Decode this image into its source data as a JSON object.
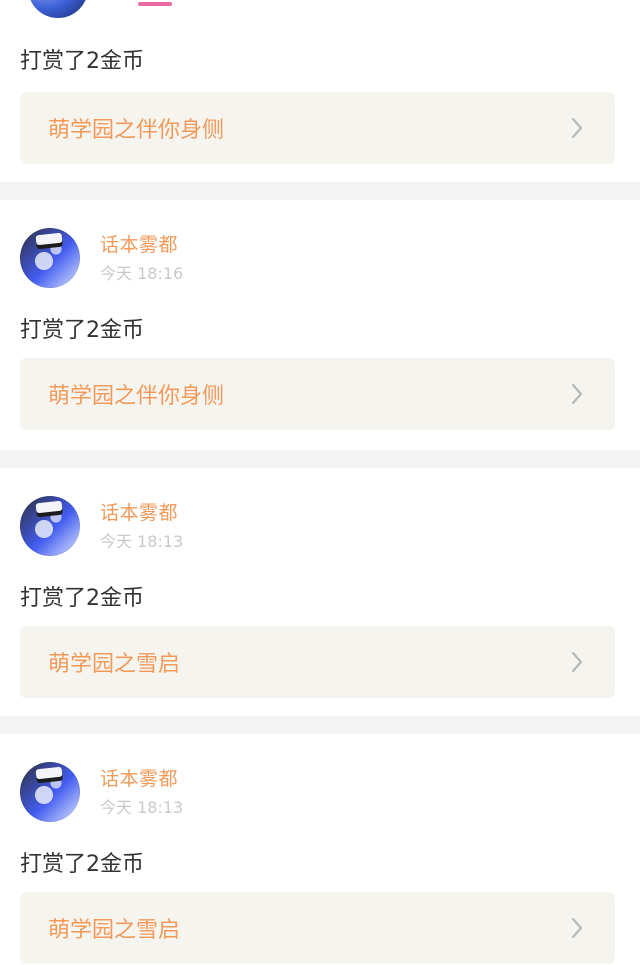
{
  "top_card": {
    "reward_text": "打赏了2金币",
    "link_title": "萌学园之伴你身侧"
  },
  "cards": [
    {
      "username": "话本雾都",
      "time": "今天 18:16",
      "reward_text": "打赏了2金币",
      "link_title": "萌学园之伴你身侧"
    },
    {
      "username": "话本雾都",
      "time": "今天 18:13",
      "reward_text": "打赏了2金币",
      "link_title": "萌学园之雪启"
    },
    {
      "username": "话本雾都",
      "time": "今天 18:13",
      "reward_text": "打赏了2金币",
      "link_title": "萌学园之雪启"
    }
  ],
  "icons": {
    "avatar": "anime-avatar-icon",
    "chevron": "chevron-right-icon"
  },
  "colors": {
    "accent_orange": "#f39a5b",
    "separator": "#f3f3f3",
    "link_bg": "#f6f4ef",
    "time_gray": "#c9c9c9",
    "pink_mark": "#ea6aa2"
  }
}
